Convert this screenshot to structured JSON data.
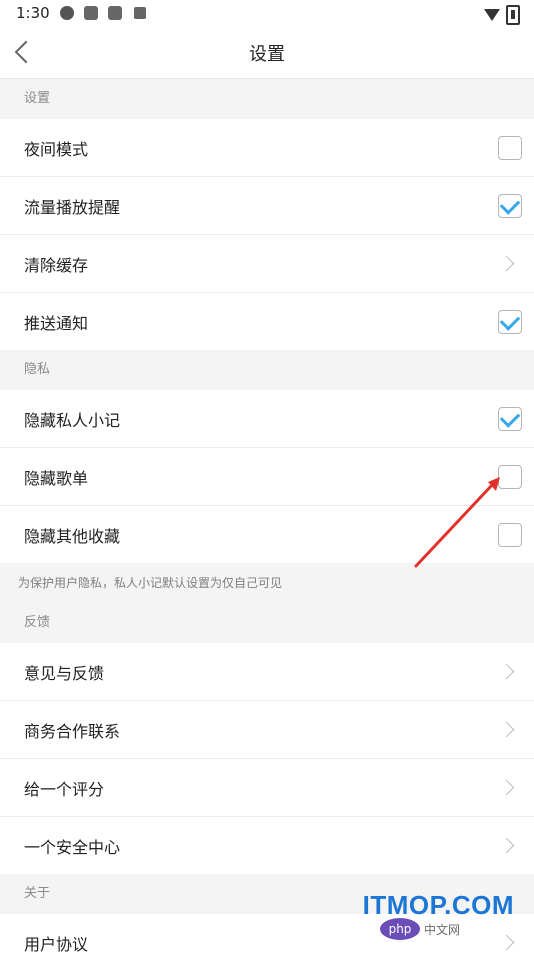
{
  "status": {
    "time": "1:30"
  },
  "header": {
    "title": "设置"
  },
  "sections": {
    "settings": {
      "title": "设置",
      "items": [
        {
          "label": "夜间模式",
          "type": "checkbox",
          "checked": false
        },
        {
          "label": "流量播放提醒",
          "type": "checkbox",
          "checked": true
        },
        {
          "label": "清除缓存",
          "type": "chevron"
        },
        {
          "label": "推送通知",
          "type": "checkbox",
          "checked": true
        }
      ]
    },
    "privacy": {
      "title": "隐私",
      "items": [
        {
          "label": "隐藏私人小记",
          "type": "checkbox",
          "checked": true
        },
        {
          "label": "隐藏歌单",
          "type": "checkbox",
          "checked": false
        },
        {
          "label": "隐藏其他收藏",
          "type": "checkbox",
          "checked": false
        }
      ],
      "note": "为保护用户隐私，私人小记默认设置为仅自己可见"
    },
    "feedback": {
      "title": "反馈",
      "items": [
        {
          "label": "意见与反馈",
          "type": "chevron"
        },
        {
          "label": "商务合作联系",
          "type": "chevron"
        },
        {
          "label": "给一个评分",
          "type": "chevron"
        },
        {
          "label": "一个安全中心",
          "type": "chevron"
        }
      ]
    },
    "about": {
      "title": "关于",
      "items": [
        {
          "label": "用户协议",
          "type": "chevron"
        }
      ]
    }
  },
  "watermark": {
    "brand": "ITMOP.COM",
    "php": "php",
    "site": "中文网"
  },
  "colors": {
    "accent": "#37a7e9",
    "arrow": "#e3312a",
    "watermark": "#1c76d6"
  }
}
